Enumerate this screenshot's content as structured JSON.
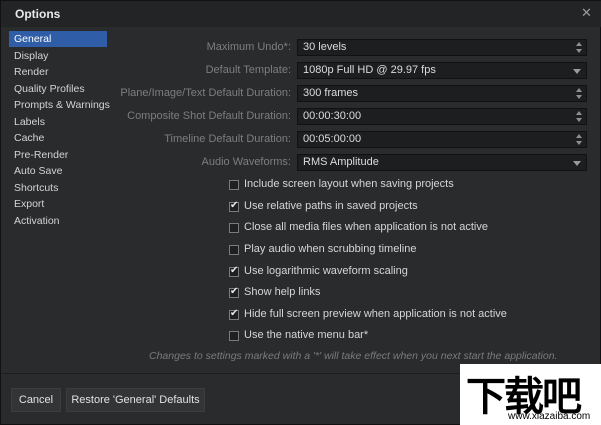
{
  "window": {
    "title": "Options"
  },
  "sidebar": {
    "items": [
      {
        "label": "General",
        "active": true
      },
      {
        "label": "Display"
      },
      {
        "label": "Render"
      },
      {
        "label": "Quality Profiles"
      },
      {
        "label": "Prompts & Warnings"
      },
      {
        "label": "Labels"
      },
      {
        "label": "Cache"
      },
      {
        "label": "Pre-Render"
      },
      {
        "label": "Auto Save"
      },
      {
        "label": "Shortcuts"
      },
      {
        "label": "Export"
      },
      {
        "label": "Activation"
      }
    ]
  },
  "settings": {
    "undo": {
      "label": "Maximum Undo*:",
      "value": "30 levels"
    },
    "template": {
      "label": "Default Template:",
      "value": "1080p Full HD @ 29.97 fps"
    },
    "plane_duration": {
      "label": "Plane/Image/Text Default Duration:",
      "value": "300 frames"
    },
    "shot_duration": {
      "label": "Composite Shot Default Duration:",
      "value": "00:00:30:00"
    },
    "timeline_duration": {
      "label": "Timeline Default Duration:",
      "value": "00:05:00:00"
    },
    "waveforms": {
      "label": "Audio Waveforms:",
      "value": "RMS Amplitude"
    }
  },
  "checkboxes": [
    {
      "label": "Include screen layout when saving projects",
      "checked": false
    },
    {
      "label": "Use relative paths in saved projects",
      "checked": true
    },
    {
      "label": "Close all media files when application is not active",
      "checked": false
    },
    {
      "label": "Play audio when scrubbing timeline",
      "checked": false
    },
    {
      "label": "Use logarithmic waveform scaling",
      "checked": true
    },
    {
      "label": "Show help links",
      "checked": true
    },
    {
      "label": "Hide full screen preview when application is not active",
      "checked": true
    },
    {
      "label": "Use the native menu bar*",
      "checked": false
    }
  ],
  "note": "Changes to settings marked with a '*' will take effect when you next start the application.",
  "footer": {
    "cancel": "Cancel",
    "restore": "Restore 'General' Defaults"
  },
  "watermark": {
    "big": "下载吧",
    "small": "www.xiazaiba.com"
  },
  "colors": {
    "accent": "#2f5da7",
    "background": "#2a2b2d",
    "field": "#1d1e20"
  }
}
